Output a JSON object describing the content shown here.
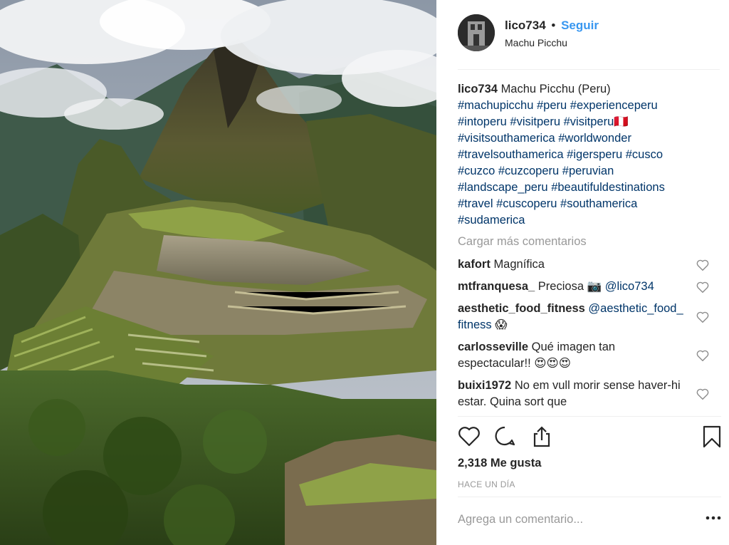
{
  "photo": {
    "alt": "Machu Picchu"
  },
  "header": {
    "username": "lico734",
    "separator": "•",
    "follow_label": "Seguir",
    "location": "Machu Picchu"
  },
  "caption": {
    "username": "lico734",
    "text": "Machu Picchu (Peru)",
    "hashtags": [
      "#machupicchu",
      "#peru",
      "#experienceperu",
      "#intoperu",
      "#visitperu",
      "#visitperu🇵🇪",
      "#visitsouthamerica",
      "#worldwonder",
      "#travelsouthamerica",
      "#igersperu",
      "#cusco",
      "#cuzco",
      "#cuzcoperu",
      "#peruvian",
      "#landscape_peru",
      "#beautifuldestinations",
      "#travel",
      "#cuscoperu",
      "#southamerica",
      "#sudamerica"
    ]
  },
  "load_more": "Cargar más comentarios",
  "comments": [
    {
      "user": "kafort",
      "text": "Magnífica",
      "mention": ""
    },
    {
      "user": "mtfranquesa_",
      "text": "Preciosa 📷",
      "mention": "@lico734"
    },
    {
      "user": "aesthetic_food_fitness",
      "text": "",
      "mention": "@aesthetic_food_fitness",
      "suffix": "😱"
    },
    {
      "user": "carlosseville",
      "text": "Qué imagen tan espectacular!! 😍😍😍",
      "mention": ""
    },
    {
      "user": "buixi1972",
      "text": "No em vull morir sense haver-hi estar. Quina sort que",
      "mention": ""
    }
  ],
  "likes": "2,318 Me gusta",
  "timestamp": "HACE UN DÍA",
  "add_comment": {
    "placeholder": "Agrega un comentario..."
  },
  "icons": {
    "like": "heart-icon",
    "comment": "comment-bubble-icon",
    "share": "share-icon",
    "save": "bookmark-icon",
    "options": "more-options-icon",
    "comment_like": "heart-small-icon"
  },
  "colors": {
    "link": "#003569",
    "follow": "#3897f0",
    "muted": "#999999",
    "text": "#262626"
  }
}
